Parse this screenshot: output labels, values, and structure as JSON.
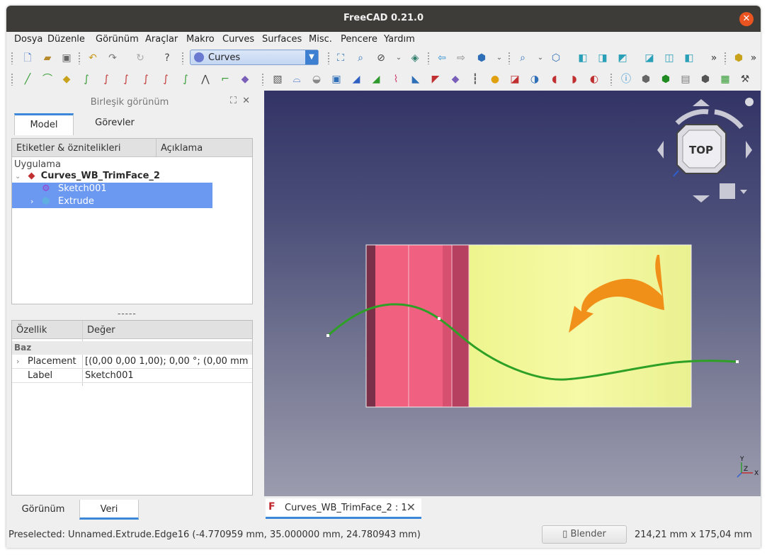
{
  "window": {
    "title": "FreeCAD 0.21.0"
  },
  "menu": [
    "Dosya",
    "Düzenle",
    "Görünüm",
    "Araçlar",
    "Makro",
    "Curves",
    "Surfaces",
    "Misc.",
    "Pencere",
    "Yardım"
  ],
  "workbench": {
    "selected": "Curves"
  },
  "combo_view": {
    "title": "Birleşik görünüm",
    "tabs": [
      "Model",
      "Görevler"
    ],
    "tree": {
      "columns": [
        "Etiketler & öznitelikleri",
        "Açıklama"
      ],
      "section": "Uygulama",
      "document": "Curves_WB_TrimFace_2",
      "items": [
        "Sketch001",
        "Extrude"
      ]
    },
    "splitter": "-----",
    "properties": {
      "columns": [
        "Özellik",
        "Değer"
      ],
      "group": "Baz",
      "rows": [
        {
          "name": "Placement",
          "value": "[(0,00 0,00 1,00); 0,00 °; (0,00 mm  ..."
        },
        {
          "name": "Label",
          "value": "Sketch001"
        }
      ]
    },
    "bottom_tabs": [
      "Görünüm",
      "Veri"
    ]
  },
  "navcube": {
    "face": "TOP"
  },
  "axes": {
    "x": "X",
    "y": "Y",
    "z": "Z"
  },
  "document_tab": {
    "label": "Curves_WB_TrimFace_2 : 1"
  },
  "status": {
    "message": "Preselected: Unnamed.Extrude.Edge16 (-4.770959 mm, 35.000000 mm, 24.780943 mm)",
    "nav_style": "Blender",
    "dimensions": "214,21 mm x 175,04 mm"
  },
  "colors": {
    "accent": "#3b88d8",
    "selection": "#6b98f0",
    "titlebar": "#3d3c38",
    "close": "#e95420",
    "face_pink": "#f2607f",
    "face_yellow": "#f6f9a2",
    "curve_green": "#2ea026",
    "arrow_orange": "#f08a12"
  }
}
